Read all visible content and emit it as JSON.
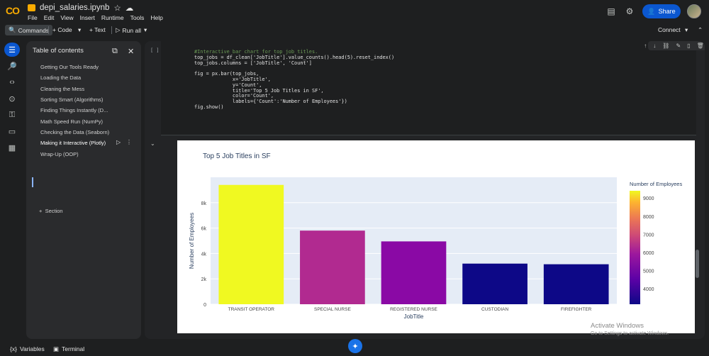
{
  "header": {
    "logo": "CO",
    "filename": "depi_salaries.ipynb",
    "menu": [
      "File",
      "Edit",
      "View",
      "Insert",
      "Runtime",
      "Tools",
      "Help"
    ],
    "share_label": "Share"
  },
  "toolbar": {
    "commands": "Commands",
    "code": "+ Code",
    "text": "+ Text",
    "run_all": "Run all",
    "connect": "Connect"
  },
  "toc": {
    "title": "Table of contents",
    "items": [
      "Getting Our Tools Ready",
      "Loading the Data",
      "Cleaning the Mess",
      "Sorting Smart (Algorithms)",
      "Finding Things Instantly (D...",
      "Math Speed Run (NumPy)",
      "Checking the Data (Seaborn)",
      "Making it Interactive (Plotly)",
      "Wrap-Up (OOP)"
    ],
    "section": "Section"
  },
  "cell": {
    "bracket": "[ ]",
    "code_lines": [
      "#Interactive bar chart for top job titles.",
      "",
      "top_jobs = df_clean['JobTitle'].value_counts().head(5).reset_index()",
      "top_jobs.columns = ['JobTitle', 'Count']",
      "",
      "fig = px.bar(top_jobs,",
      "             x='JobTitle',",
      "             y='Count',",
      "             title='Top 5 Job Titles in SF',",
      "             color='Count',",
      "             labels={'Count':'Number of Employees'})",
      "fig.show()"
    ]
  },
  "status": {
    "variables": "Variables",
    "terminal": "Terminal"
  },
  "watermark": {
    "line1": "Activate Windows",
    "line2": "Go to Settings to activate Windows."
  },
  "chart_data": {
    "type": "bar",
    "title": "Top 5 Job Titles in SF",
    "xlabel": "JobTitle",
    "ylabel": "Number of Employees",
    "categories": [
      "TRANSIT OPERATOR",
      "SPECIAL NURSE",
      "REGISTERED NURSE",
      "CUSTODIAN",
      "FIREFIGHTER"
    ],
    "values": [
      9400,
      5800,
      4950,
      3200,
      3150
    ],
    "colors": [
      "#f0f921",
      "#b12a90",
      "#8a09a5",
      "#0d0887",
      "#0d0887"
    ],
    "ylim": [
      0,
      10000
    ],
    "yticks": [
      0,
      2000,
      4000,
      6000,
      8000
    ],
    "ytick_labels": [
      "0",
      "2k",
      "4k",
      "6k",
      "8k"
    ],
    "colorbar": {
      "title": "Number of Employees",
      "ticks": [
        4000,
        5000,
        6000,
        7000,
        8000,
        9000
      ],
      "range": [
        3150,
        9400
      ]
    },
    "grid": true,
    "plot_bg": "#e5ecf6"
  }
}
